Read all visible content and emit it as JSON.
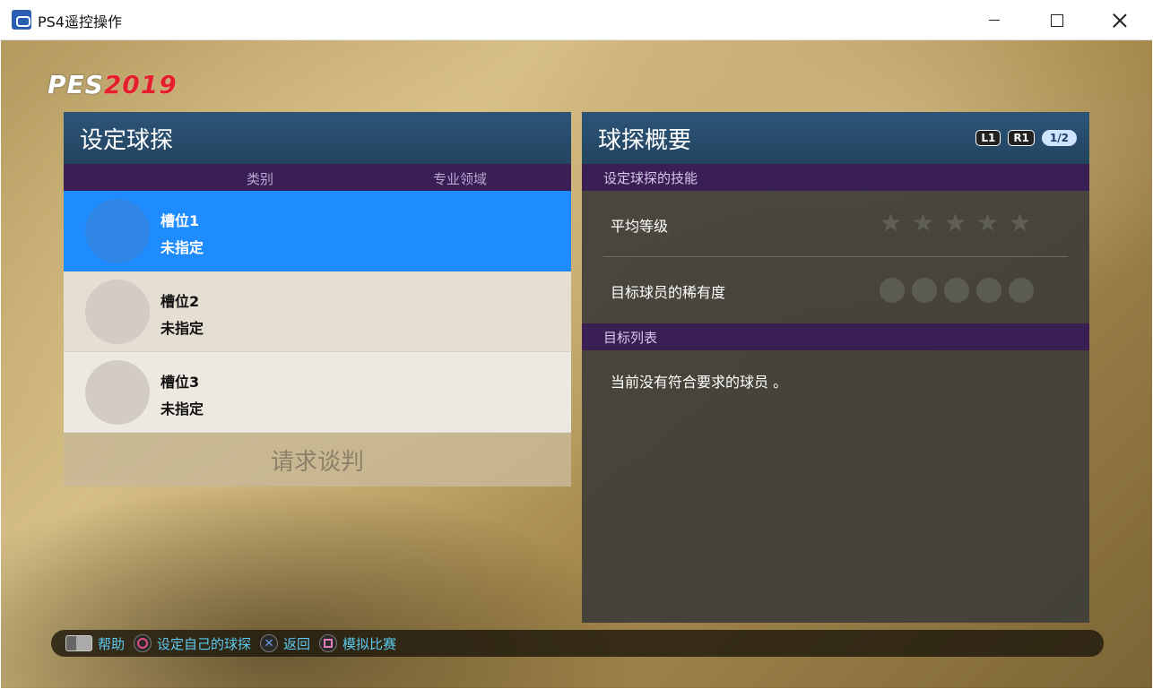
{
  "window": {
    "title": "PS4遥控操作"
  },
  "logo": {
    "pes": "PES",
    "year": "2019"
  },
  "left_panel": {
    "title": "设定球探",
    "columns": {
      "category": "类别",
      "specialty": "专业领域"
    },
    "slots": [
      {
        "name": "槽位1",
        "status": "未指定",
        "selected": true
      },
      {
        "name": "槽位2",
        "status": "未指定",
        "selected": false
      },
      {
        "name": "槽位3",
        "status": "未指定",
        "selected": false
      }
    ],
    "negotiate_label": "请求谈判"
  },
  "right_panel": {
    "title": "球探概要",
    "badges": {
      "l1": "L1",
      "r1": "R1",
      "page": "1/2"
    },
    "skills_header": "设定球探的技能",
    "average_level_label": "平均等级",
    "average_level_stars_filled": 0,
    "average_level_stars_total": 5,
    "rarity_label": "目标球员的稀有度",
    "rarity_dots_filled": 0,
    "rarity_dots_total": 5,
    "target_list_header": "目标列表",
    "empty_message": "当前没有符合要求的球员 。"
  },
  "bottom_bar": {
    "help": "帮助",
    "set_scout": "设定自己的球探",
    "back": "返回",
    "simulate": "模拟比赛"
  },
  "colors": {
    "selected_row": "#1e8cff",
    "panel_header": "#2d5478",
    "section_header": "#3a1f55",
    "hint_text": "#5cc9f0",
    "logo_year": "#e3202c"
  }
}
